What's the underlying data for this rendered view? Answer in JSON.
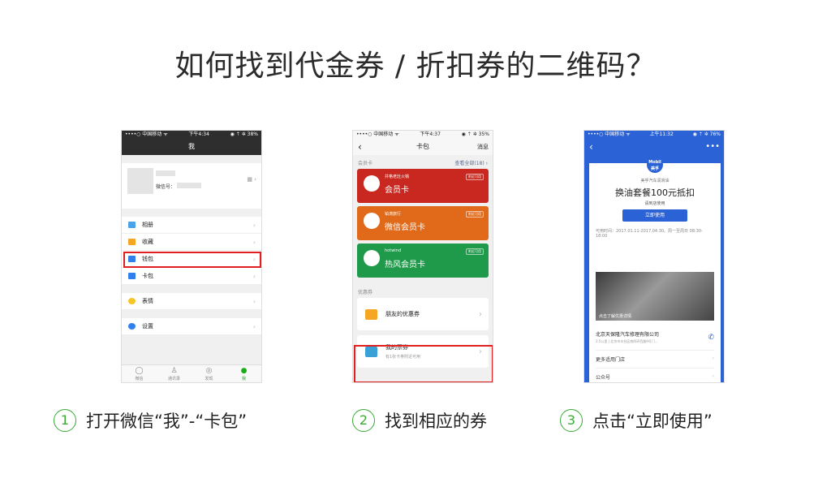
{
  "title": "如何找到代金券 / 折扣券的二维码？",
  "phone1": {
    "status_left": "••••○ 中国移动 ᯤ",
    "status_time": "下午4:34",
    "status_right": "◉ ⇡ ✲ 38%",
    "nav_title": "我",
    "wechat_id_label": "微信号：",
    "menu": [
      {
        "label": "相册",
        "color": "#4aa3e8"
      },
      {
        "label": "收藏",
        "color": "#f5a623"
      },
      {
        "label": "钱包",
        "color": "#2f80ed"
      },
      {
        "label": "卡包",
        "color": "#2f80ed"
      }
    ],
    "emoji_label": "表情",
    "settings_label": "设置",
    "tabs": [
      "微信",
      "通讯录",
      "发现",
      "我"
    ]
  },
  "phone2": {
    "status_left": "••••○ 中国移动 ᯤ",
    "status_time": "下午4:37",
    "status_right": "◉ ⇡ ✲ 35%",
    "nav_title": "卡包",
    "nav_right": "消息",
    "member_section": "会员卡",
    "view_all": "查看全部(18) ›",
    "cards": [
      {
        "brand": "井格老灶火锅",
        "name": "会员卡",
        "tag": "附近可用",
        "color": "#c8281f"
      },
      {
        "brand": "铂涛旅行",
        "name": "微信会员卡",
        "tag": "附近可用",
        "color": "#e06a1a"
      },
      {
        "brand": "hotwind",
        "name": "热风会员卡",
        "tag": "附近可用",
        "color": "#1e9a4a"
      }
    ],
    "coupon_section": "优惠券",
    "friend_coupon": "朋友的优惠券",
    "my_tickets": "我的票券",
    "my_tickets_sub": "有1张卡券附近可用"
  },
  "phone3": {
    "status_left": "••••○ 中国移动 ᯤ",
    "status_time": "上午11:32",
    "status_right": "◉ ⇡ ✲ 76%",
    "logo_text": "Mobil 美孚",
    "brand": "美孚汽车润滑油",
    "coupon_title": "换油套餐100元抵扣",
    "coupon_sub": "请到店使用",
    "use_button": "立即使用",
    "valid_time": "可用时间：2017.01.11-2017.04.30。周一至周日 08:30-18:00",
    "image_caption": "点击了解优惠详情",
    "shop_name": "北京天保隆汽车修理有限公司",
    "shop_addr": "3.5公里 | 北京市丰台区南四环西路9号门...",
    "more_shops": "更多适用门店",
    "official_account": "公众号"
  },
  "steps": [
    {
      "num": "1",
      "text": "打开微信“我”-“卡包”"
    },
    {
      "num": "2",
      "text": "找到相应的券"
    },
    {
      "num": "3",
      "text": "点击“立即使用”"
    }
  ]
}
